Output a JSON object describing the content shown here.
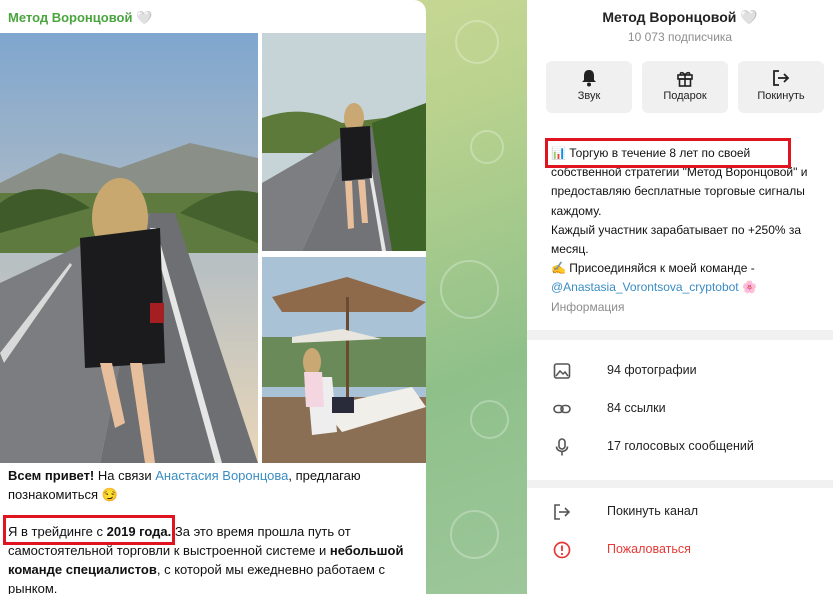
{
  "message": {
    "author": "Метод Воронцовой 🤍",
    "intro_bold": "Всем привет!",
    "intro_text": " На связи ",
    "intro_link": "Анастасия Воронцова",
    "intro_tail": ", предлагаю познакомиться 😏",
    "p2_start": "Я в трейдинге с ",
    "p2_year": "2019 года.",
    "p2_text": " За это время прошла путь от самостоятельной торговли к выстроенной системе и ",
    "p2_bold": "небольшой команде специалистов",
    "p2_tail": ", с которой мы ежедневно работаем с рынком."
  },
  "channel": {
    "title": "Метод Воронцовой 🤍",
    "subscribers": "10 073 подписчика",
    "actions": [
      {
        "label": "Звук",
        "icon": "bell-icon"
      },
      {
        "label": "Подарок",
        "icon": "gift-icon"
      },
      {
        "label": "Покинуть",
        "icon": "leave-icon"
      }
    ],
    "description": {
      "line1": "📊 Торгую в течение 8 лет по своей",
      "line2": "собственной стратегии \"Метод Воронцовой\" и предоставляю бесплатные торговые сигналы каждому.",
      "line3": "Каждый участник зарабатывает по +250% за месяц.",
      "line4": "✍️ Присоединяйся к моей команде -",
      "link": "@Anastasia_Vorontsova_cryptobot",
      "link_emoji": " 🌸",
      "info_label": "Информация"
    },
    "media": [
      {
        "label": "94 фотографии",
        "icon": "photo-icon"
      },
      {
        "label": "84 ссылки",
        "icon": "link-icon"
      },
      {
        "label": "17 голосовых сообщений",
        "icon": "microphone-icon"
      }
    ],
    "leave": {
      "label": "Покинуть канал",
      "icon": "leave-icon"
    },
    "report": {
      "label": "Пожаловаться",
      "icon": "warning-icon"
    }
  },
  "colors": {
    "author": "#4aa53f",
    "link": "#3a8cc4",
    "highlight": "#e0141f",
    "danger": "#e53935"
  }
}
